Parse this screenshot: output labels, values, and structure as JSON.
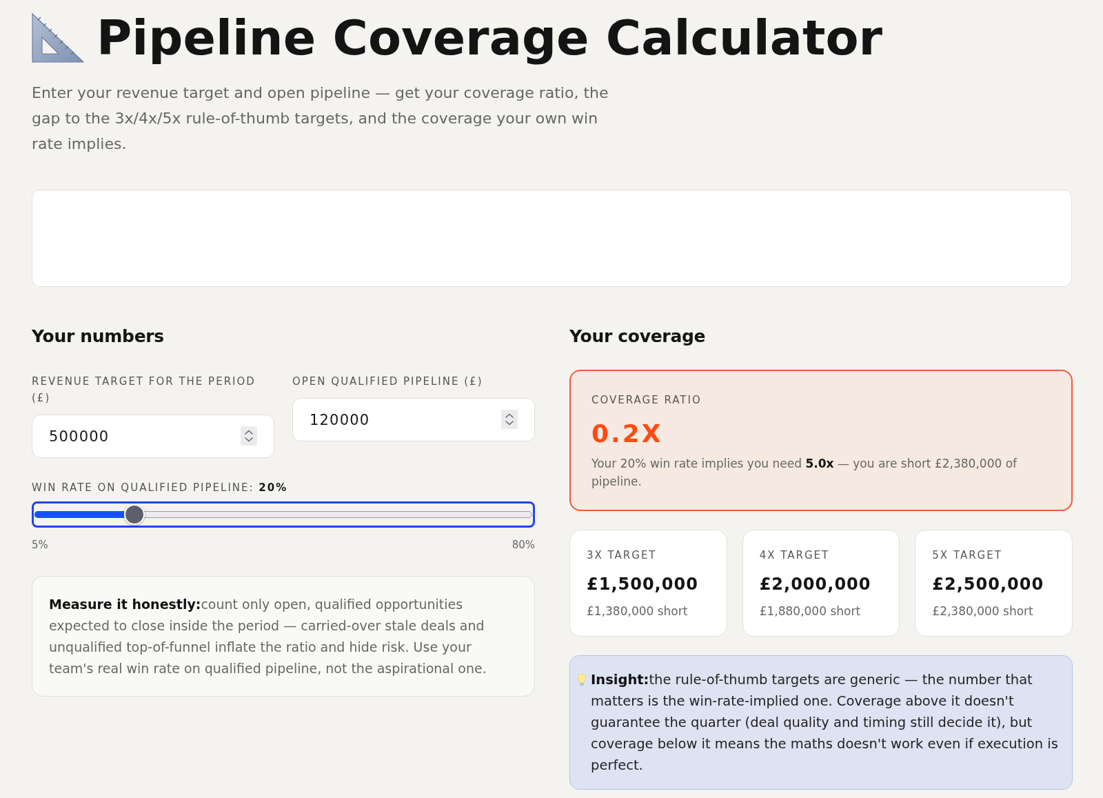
{
  "header": {
    "title": "Pipeline Coverage Calculator",
    "subtitle": "Enter your revenue target and open pipeline — get your coverage ratio, the gap to the 3x/4x/5x rule-of-thumb targets, and the coverage your own win rate implies."
  },
  "inputs": {
    "heading": "Your numbers",
    "fields": [
      {
        "label": "REVENUE TARGET FOR THE PERIOD (£)",
        "value": "500000"
      },
      {
        "label": "OPEN QUALIFIED PIPELINE (£)",
        "value": "120000"
      }
    ],
    "win_rate": {
      "label": "WIN RATE ON QUALIFIED PIPELINE: **20%**",
      "level": 0.2,
      "focused": true,
      "min_label": "5%",
      "max_label": "80%"
    },
    "note": "**Measure it honestly:**count only open, qualified opportunities expected to close inside the period — carried-over stale deals and unqualified top-of-funnel inflate the ratio and hide risk. Use your team's real win rate on qualified pipeline, not the aspirational one."
  },
  "coverage": {
    "heading": "Your coverage",
    "ratio": {
      "label": "COVERAGE RATIO",
      "value": "0.2X",
      "summary": "Your 20% win rate implies you need **5.0x** — you are short £2,380,000 of pipeline."
    },
    "targets": [
      {
        "label": "3X TARGET",
        "value": "£1,500,000",
        "gap": "£1,380,000 short"
      },
      {
        "label": "4X TARGET",
        "value": "£2,000,000",
        "gap": "£1,880,000 short"
      },
      {
        "label": "5X TARGET",
        "value": "£2,500,000",
        "gap": "£2,380,000 short"
      }
    ],
    "insight": "**Insight:**the rule-of-thumb targets are generic — the number that matters is the win-rate-implied one. Coverage above it doesn't guarantee the quarter (deal quality and timing still decide it), but coverage below it means the maths doesn't work even if execution is perfect."
  }
}
